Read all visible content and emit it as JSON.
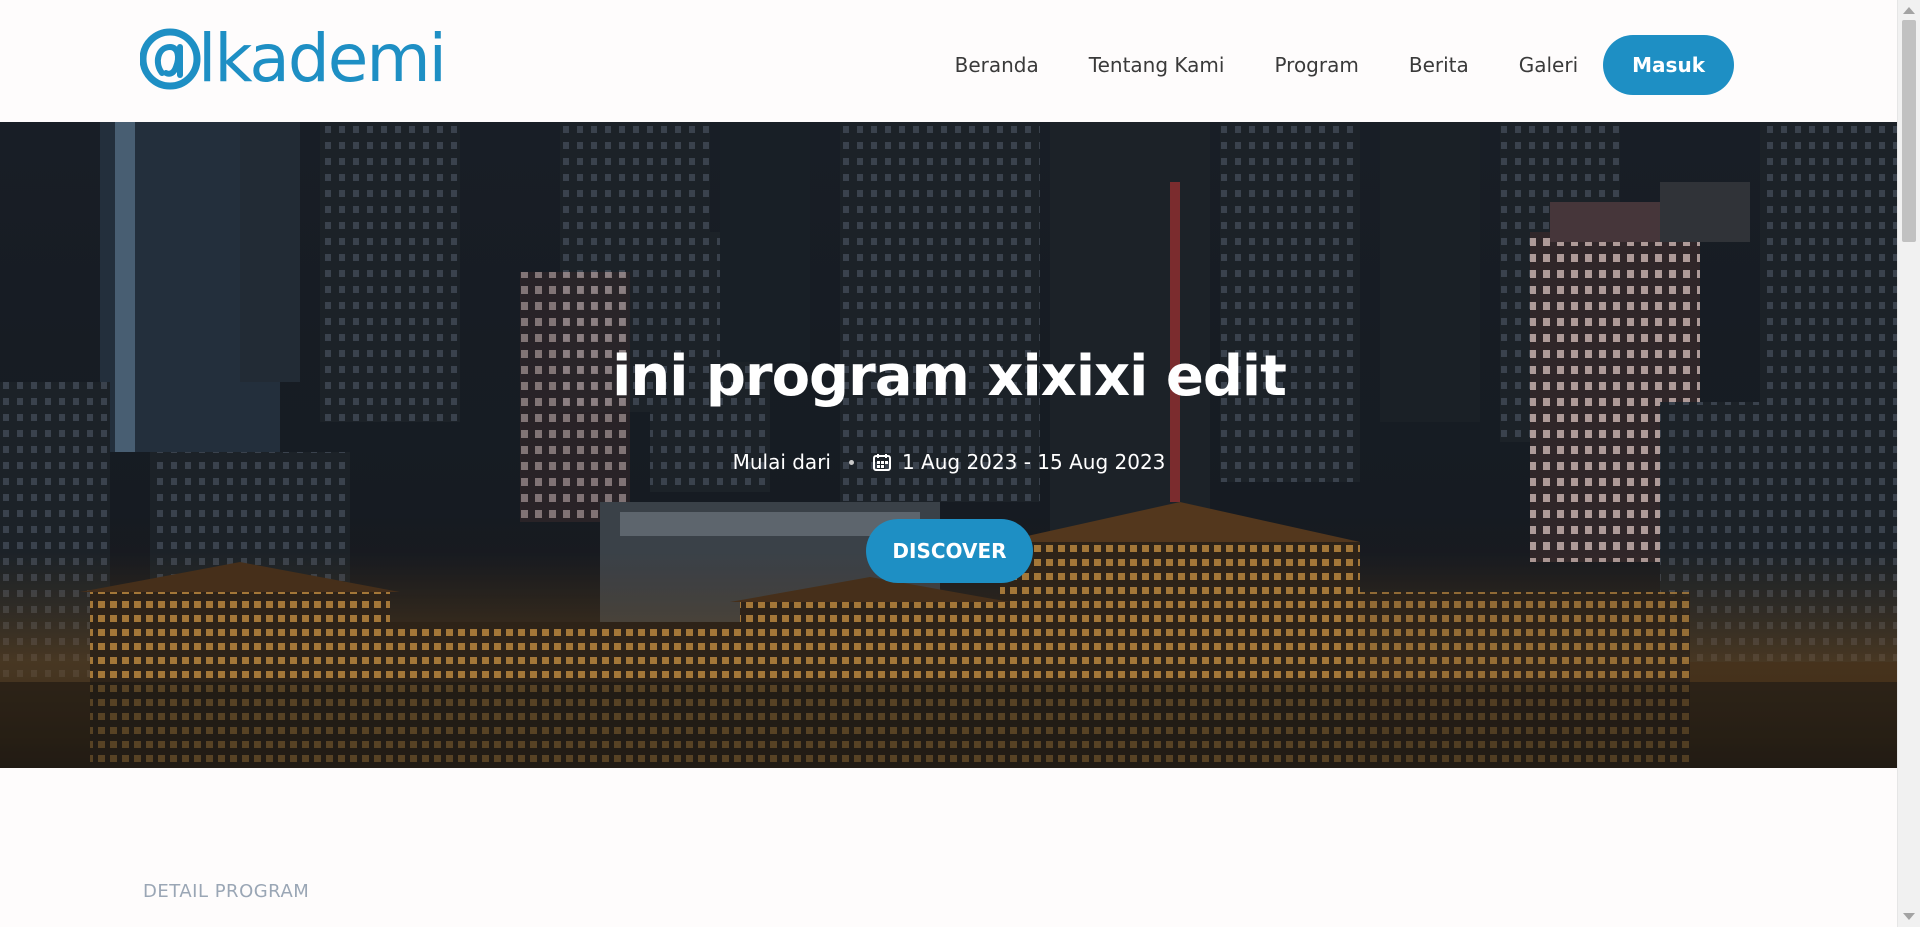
{
  "header": {
    "logo_text": "lkademi",
    "nav": [
      "Beranda",
      "Tentang Kami",
      "Program",
      "Berita",
      "Galeri"
    ],
    "login_label": "Masuk"
  },
  "hero": {
    "title": "ini program xixixi edit",
    "start_label": "Mulai dari",
    "date_range": "1 Aug 2023 - 15 Aug 2023",
    "button_label": "DISCOVER"
  },
  "section": {
    "label": "DETAIL PROGRAM"
  },
  "colors": {
    "brand": "#1e8fc4",
    "background": "#fefcfc",
    "muted_label": "#9aa6b5"
  },
  "icons": [
    "academy-logo-icon",
    "calendar-icon",
    "scroll-up-icon",
    "scroll-down-icon"
  ]
}
